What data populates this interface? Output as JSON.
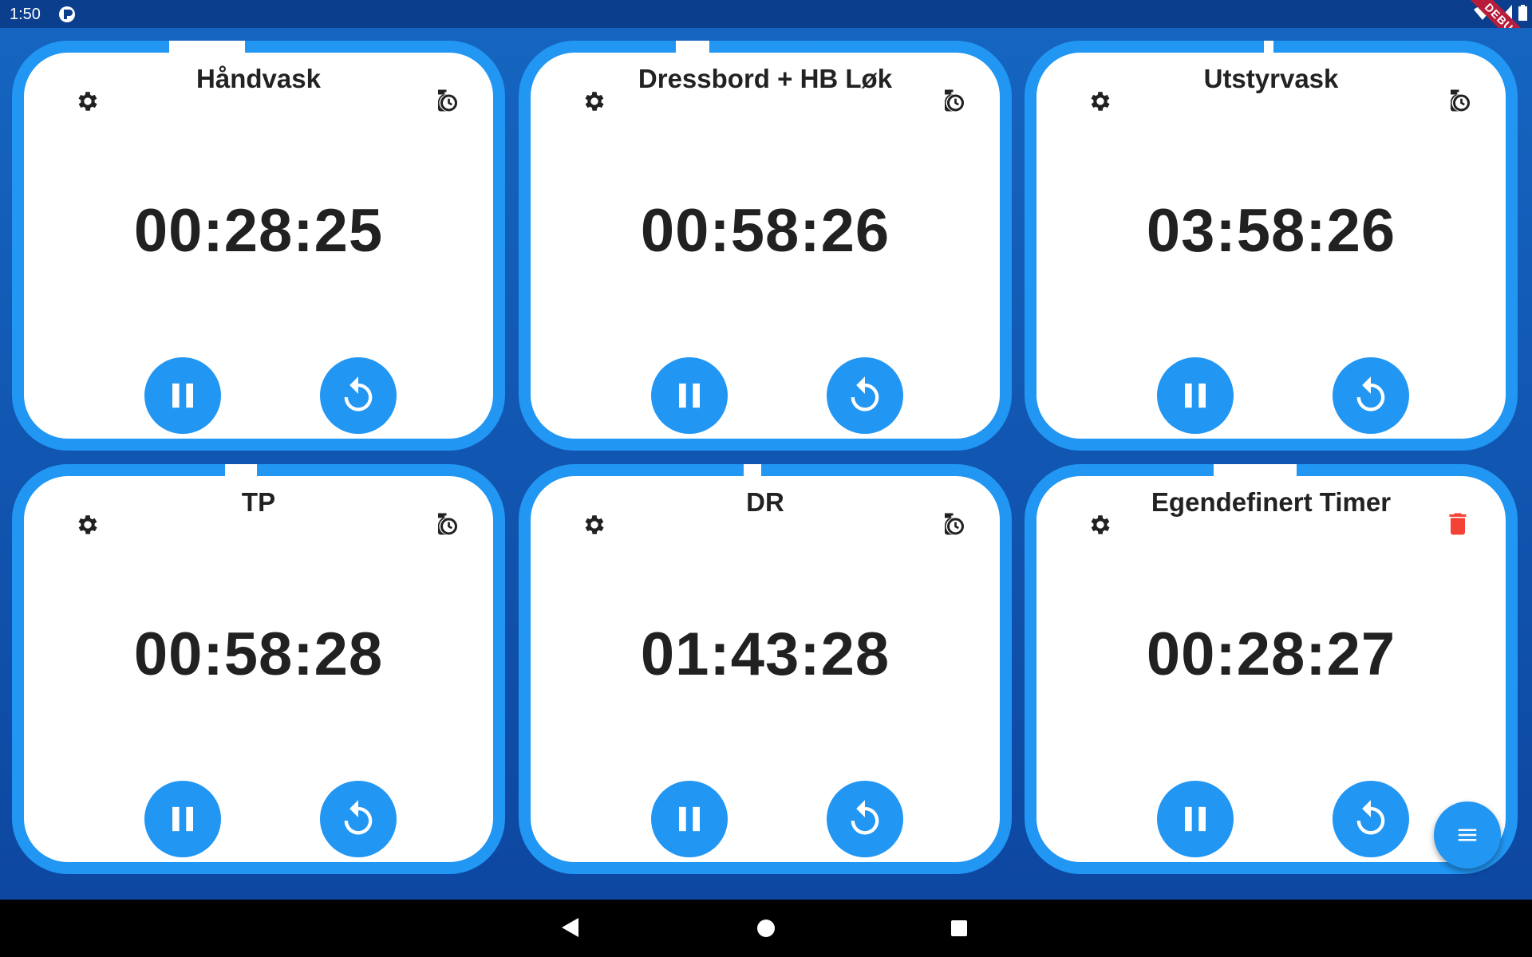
{
  "status_bar": {
    "time": "1:50",
    "debug_label": "DEBUG",
    "icons": [
      "app-notification-icon",
      "wifi-icon",
      "cell-signal-icon",
      "battery-icon"
    ]
  },
  "colors": {
    "accent": "#2196f3",
    "background": "#0d47a1",
    "danger": "#f44336",
    "timer_text": "#212121"
  },
  "timers": [
    {
      "title": "Håndvask",
      "time": "00:28:25",
      "corner_icon": "timer-history-icon"
    },
    {
      "title": "Dressbord + HB Løk",
      "time": "00:58:26",
      "corner_icon": "timer-history-icon"
    },
    {
      "title": "Utstyrvask",
      "time": "03:58:26",
      "corner_icon": "timer-history-icon"
    },
    {
      "title": "TP",
      "time": "00:58:28",
      "corner_icon": "timer-history-icon"
    },
    {
      "title": "DR",
      "time": "01:43:28",
      "corner_icon": "timer-history-icon"
    },
    {
      "title": "Egendefinert Timer",
      "time": "00:28:27",
      "corner_icon": "trash-icon"
    }
  ],
  "fab": {
    "icon": "menu-icon"
  },
  "nav_bar": {
    "icons": [
      "back-icon",
      "home-icon",
      "recents-icon"
    ]
  }
}
